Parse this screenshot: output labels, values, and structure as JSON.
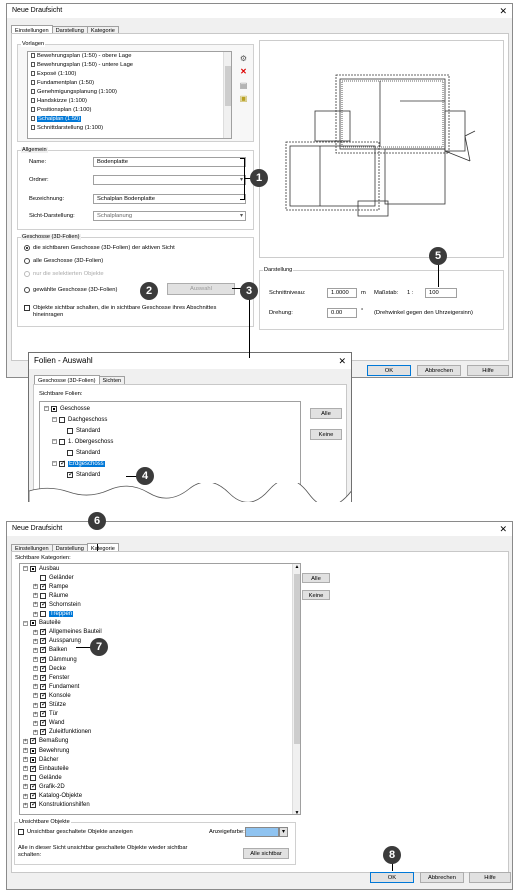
{
  "dialog1": {
    "title": "Neue Draufsicht",
    "tabs": [
      "Einstellungen",
      "Darstellung",
      "Kategorie"
    ],
    "vorlagen": {
      "label": "Vorlagen",
      "items": [
        "Bewehrungsplan (1:50) - obere Lage",
        "Bewehrungsplan (1:50) - untere Lage",
        "Exposé (1:100)",
        "Fundamentplan (1:50)",
        "Genehmigungsplanung (1:100)",
        "Handskizze (1:100)",
        "Positionsplan (1:100)",
        "Schalplan (1:50)",
        "Schnittdarstellung (1:100)"
      ],
      "selected": "Schalplan (1:50)"
    },
    "allgemein": {
      "label": "Allgemein",
      "name_label": "Name:",
      "name_value": "Bodenplatte",
      "ordner_label": "Ordner:",
      "ordner_value": "",
      "bez_label": "Bezeichnung:",
      "bez_value": "Schalplan Bodenplatte",
      "sicht_label": "Sicht-Darstellung:",
      "sicht_value": "Schalplanung"
    },
    "geschosse": {
      "label": "Geschosse (3D-Folien)",
      "opt1": "die sichtbaren Geschosse (3D-Folien) der aktiven Sicht",
      "opt2": "alle Geschosse (3D-Folien)",
      "opt3": "nur die selektierten Objekte",
      "opt4": "gewählte Geschosse (3D-Folien)",
      "auswahl": "Auswahl",
      "chk_text_1": "Objekte sichtbar schalten, die in sichtbare Geschosse ihres Abschnittes",
      "chk_text_2": "hineinragen"
    },
    "darstellung": {
      "label": "Darstellung",
      "schnitt_label": "Schnittniveau:",
      "schnitt_value": "1.0000",
      "schnitt_unit": "m",
      "mass_label": "Maßstab:",
      "mass_prefix": "1 :",
      "mass_value": "100",
      "dreh_label": "Drehung:",
      "dreh_value": "0.00",
      "dreh_unit": "°",
      "dreh_note": "(Drehwinkel gegen den Uhrzeigersinn)"
    },
    "buttons": {
      "ok": "OK",
      "abbrechen": "Abbrechen",
      "hilfe": "Hilfe"
    }
  },
  "folien": {
    "title": "Folien - Auswahl",
    "tabs": [
      "Geschosse (3D-Folien)",
      "Sichten"
    ],
    "label": "Sichtbare Folien:",
    "nodes": [
      "Geschosse",
      "Dachgeschoss",
      "Standard",
      "1. Obergeschoss",
      "Standard",
      "Erdgeschoss",
      "Standard"
    ],
    "alle": "Alle",
    "keine": "Keine"
  },
  "dialog2": {
    "title": "Neue Draufsicht",
    "tabs": [
      "Einstellungen",
      "Darstellung",
      "Kategorie"
    ],
    "label": "Sichtbare Kategorien:",
    "nodes": [
      "Ausbau",
      "Geländer",
      "Rampe",
      "Räume",
      "Schornstein",
      "Treppen",
      "Bauteile",
      "Allgemeines Bauteil",
      "Aussparung",
      "Balken",
      "Dämmung",
      "Decke",
      "Fenster",
      "Fundament",
      "Konsole",
      "Stütze",
      "Tür",
      "Wand",
      "Zuleitfunktionen",
      "Bemaßung",
      "Bewehrung",
      "Dächer",
      "Einbauteile",
      "Gelände",
      "Grafik-2D",
      "Katalog-Objekte",
      "Konstruktionshilfen"
    ],
    "alle": "Alle",
    "keine": "Keine",
    "unsichtbar_label": "Unsichtbare Objekte",
    "unsichtbar_chk": "Unsichtbar geschaltete Objekte anzeigen",
    "anzeigefarbe": "Anzeigefarbe:",
    "alle_note_1": "Alle in dieser Sicht unsichtbar geschaltete Objekte wieder sichtbar",
    "alle_note_2": "schalten:",
    "alle_sichtbar": "Alle sichtbar",
    "buttons": {
      "ok": "OK",
      "abbrechen": "Abbrechen",
      "hilfe": "Hilfe"
    }
  },
  "callouts": [
    "1",
    "2",
    "3",
    "4",
    "5",
    "6",
    "7",
    "8"
  ],
  "colors": {
    "callout": "#3b3b3b",
    "selection": "#0078d7",
    "anzeigefarbe": "#8fc3f0"
  }
}
